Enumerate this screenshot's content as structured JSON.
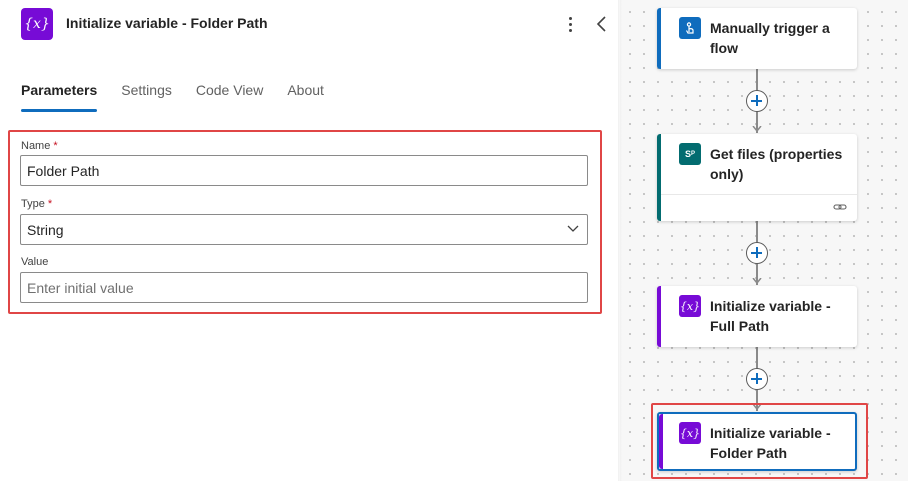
{
  "panel": {
    "title": "Initialize variable - Folder Path",
    "icon": "variable-icon",
    "tabs": [
      {
        "label": "Parameters",
        "active": true
      },
      {
        "label": "Settings",
        "active": false
      },
      {
        "label": "Code View",
        "active": false
      },
      {
        "label": "About",
        "active": false
      }
    ],
    "fields": {
      "name": {
        "label": "Name",
        "required": "*",
        "value": "Folder Path"
      },
      "type": {
        "label": "Type",
        "required": "*",
        "value": "String"
      },
      "value": {
        "label": "Value",
        "placeholder": "Enter initial value"
      }
    }
  },
  "flow": {
    "steps": [
      {
        "title": "Manually trigger a flow",
        "icon": "touch-trigger-icon",
        "accent": "#0f6cbd",
        "icon_bg": "#0f6cbd"
      },
      {
        "title": "Get files (properties only)",
        "icon": "sharepoint-icon",
        "accent": "#036c70",
        "icon_bg": "#036c70"
      },
      {
        "title": "Initialize variable - Full Path",
        "icon": "variable-icon",
        "accent": "#770bd6",
        "icon_bg": "#770bd6"
      },
      {
        "title": "Initialize variable - Folder Path",
        "icon": "variable-icon",
        "accent": "#770bd6",
        "icon_bg": "#770bd6"
      }
    ]
  },
  "colors": {
    "accent": "#0f6cbd",
    "highlight": "#e04646",
    "variable": "#770bd6"
  }
}
